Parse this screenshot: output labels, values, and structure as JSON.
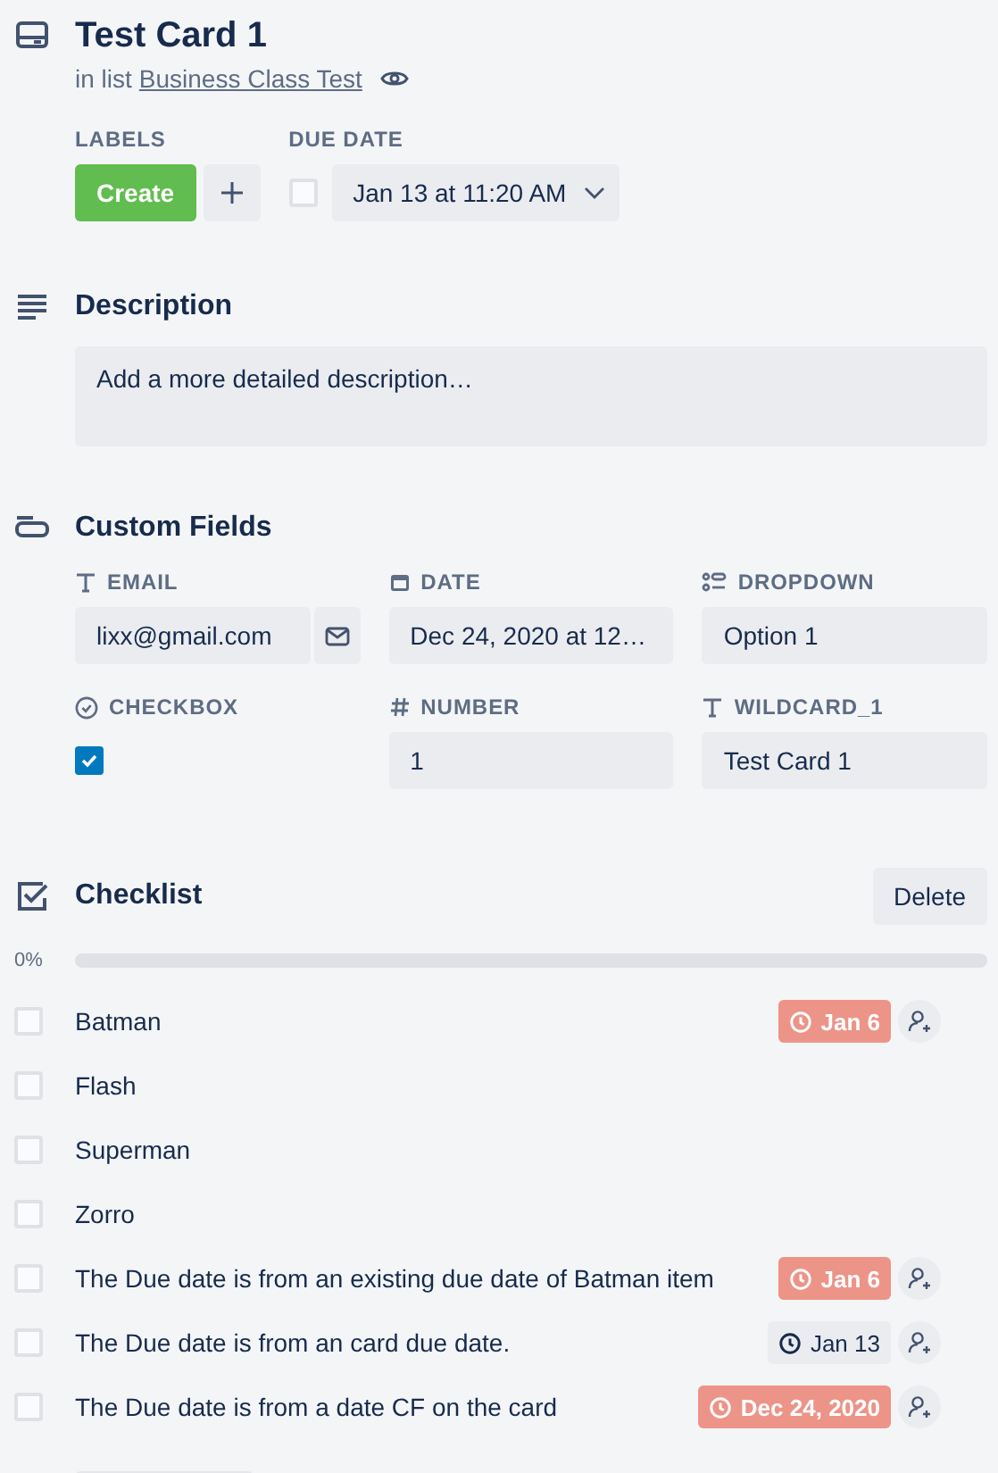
{
  "card": {
    "title": "Test Card 1",
    "list_prefix": "in list",
    "list_name": "Business Class Test"
  },
  "labels": {
    "heading": "LABELS",
    "items": [
      {
        "text": "Create",
        "color": "#61bd4f"
      }
    ]
  },
  "due_date": {
    "heading": "DUE DATE",
    "checked": false,
    "value": "Jan 13 at 11:20 AM"
  },
  "description": {
    "heading": "Description",
    "placeholder": "Add a more detailed description…"
  },
  "custom_fields": {
    "heading": "Custom Fields",
    "fields": [
      {
        "kind": "email",
        "label": "EMAIL",
        "value": "lixx@gmail.com"
      },
      {
        "kind": "date",
        "label": "DATE",
        "value": "Dec 24, 2020 at 12…"
      },
      {
        "kind": "dropdown",
        "label": "DROPDOWN",
        "value": "Option 1"
      },
      {
        "kind": "checkbox",
        "label": "CHECKBOX",
        "checked": true
      },
      {
        "kind": "number",
        "label": "NUMBER",
        "value": "1"
      },
      {
        "kind": "text",
        "label": "WILDCARD_1",
        "value": "Test Card 1"
      }
    ]
  },
  "checklist": {
    "heading": "Checklist",
    "delete_button": "Delete",
    "percent": "0%",
    "level": 0,
    "items": [
      {
        "text": "Batman",
        "checked": false,
        "due": "Jan 6",
        "overdue": true
      },
      {
        "text": "Flash",
        "checked": false
      },
      {
        "text": "Superman",
        "checked": false
      },
      {
        "text": "Zorro",
        "checked": false
      },
      {
        "text": "The Due date is from an existing due date of Batman item",
        "checked": false,
        "due": "Jan 6",
        "overdue": true
      },
      {
        "text": "The Due date is from an card due date.",
        "checked": false,
        "due": "Jan 13",
        "overdue": false
      },
      {
        "text": "The Due date is from a date CF on the card",
        "checked": false,
        "due": "Dec 24, 2020",
        "overdue": true
      }
    ]
  }
}
